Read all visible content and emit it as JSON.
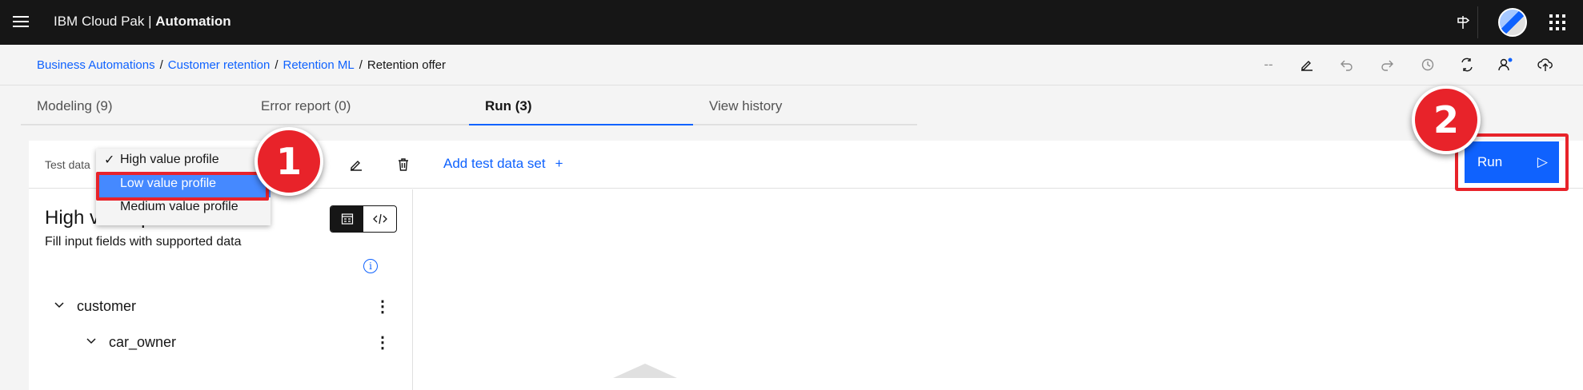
{
  "header": {
    "brand_prefix": "IBM Cloud Pak | ",
    "brand_product": "Automation",
    "icons": [
      "menu-icon",
      "signpost-icon",
      "avatar",
      "app-switcher-icon"
    ]
  },
  "breadcrumb": {
    "items": [
      "Business Automations",
      "Customer retention",
      "Retention ML"
    ],
    "current": "Retention offer",
    "separator": "/"
  },
  "toolbar": {
    "status": "--",
    "icons": [
      "edit-icon",
      "undo-icon",
      "redo-icon",
      "history-icon",
      "compare-icon",
      "user-icon",
      "upload-icon"
    ]
  },
  "tabs": [
    {
      "label": "Modeling (9)",
      "active": false
    },
    {
      "label": "Error report (0)",
      "active": false
    },
    {
      "label": "Run (3)",
      "active": true
    },
    {
      "label": "View history",
      "active": false
    }
  ],
  "run_panel": {
    "test_data_label": "Test data",
    "add_test_data_label": "Add test data set",
    "add_plus": "+",
    "run_label": "Run",
    "run_arrow": "▷"
  },
  "dropdown": {
    "checkmark": "✓",
    "options": [
      "High value profile",
      "Low value profile",
      "Medium value profile"
    ],
    "selected": "High value profile",
    "hovered": "Low value profile"
  },
  "profile": {
    "title": "High value profile",
    "subtitle": "Fill input fields with supported data",
    "info": "i"
  },
  "tree": [
    {
      "label": "customer",
      "level": 0
    },
    {
      "label": "car_owner",
      "level": 1
    }
  ],
  "callouts": [
    "1",
    "2"
  ],
  "colors": {
    "accent": "#0f62fe",
    "highlight": "#4589ff",
    "callout": "#e8232a",
    "topbar": "#161616"
  }
}
